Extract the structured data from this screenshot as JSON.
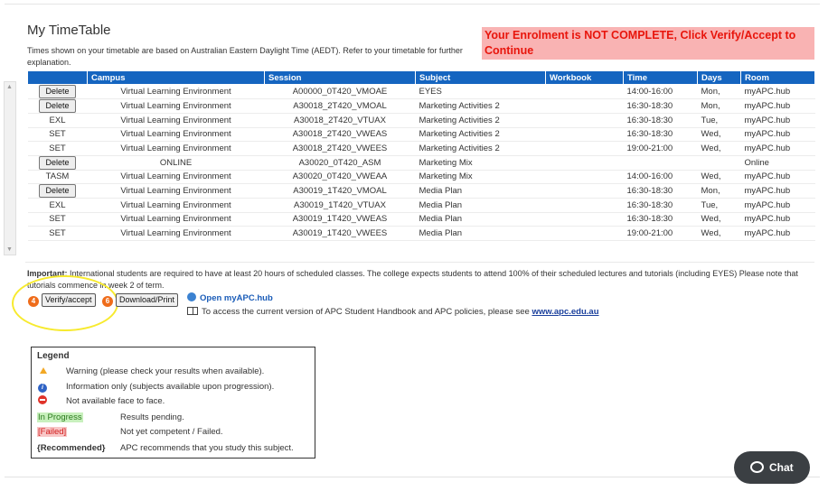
{
  "page_title": "My TimeTable",
  "timezone_notice": "Times shown on your timetable are based on Australian Eastern Daylight Time (AEDT). Refer to your timetable for further explanation.",
  "enrolment_warning": "Your Enrolment is NOT COMPLETE, Click Verify/Accept to Continue",
  "table": {
    "headers": [
      "",
      "Campus",
      "Session",
      "Subject",
      "Workbook",
      "Time",
      "Days",
      "Room"
    ],
    "rows": [
      {
        "action": "Delete",
        "action_is_button": true,
        "campus": "Virtual Learning Environment",
        "session": "A00000_0T420_VMOAE",
        "subject": "EYES",
        "workbook": "",
        "time": "14:00-16:00",
        "days": "Mon,",
        "room": "myAPC.hub"
      },
      {
        "action": "Delete",
        "action_is_button": true,
        "campus": "Virtual Learning Environment",
        "session": "A30018_2T420_VMOAL",
        "subject": "Marketing Activities 2",
        "workbook": "",
        "time": "16:30-18:30",
        "days": "Mon,",
        "room": "myAPC.hub"
      },
      {
        "action": "EXL",
        "action_is_button": false,
        "campus": "Virtual Learning Environment",
        "session": "A30018_2T420_VTUAX",
        "subject": "Marketing Activities 2",
        "workbook": "",
        "time": "16:30-18:30",
        "days": "Tue,",
        "room": "myAPC.hub"
      },
      {
        "action": "SET",
        "action_is_button": false,
        "campus": "Virtual Learning Environment",
        "session": "A30018_2T420_VWEAS",
        "subject": "Marketing Activities 2",
        "workbook": "",
        "time": "16:30-18:30",
        "days": "Wed,",
        "room": "myAPC.hub"
      },
      {
        "action": "SET",
        "action_is_button": false,
        "campus": "Virtual Learning Environment",
        "session": "A30018_2T420_VWEES",
        "subject": "Marketing Activities 2",
        "workbook": "",
        "time": "19:00-21:00",
        "days": "Wed,",
        "room": "myAPC.hub"
      },
      {
        "action": "Delete",
        "action_is_button": true,
        "campus": "ONLINE",
        "session": "A30020_0T420_ASM",
        "subject": "Marketing Mix",
        "workbook": "",
        "time": "",
        "days": "",
        "room": "Online"
      },
      {
        "action": "TASM",
        "action_is_button": false,
        "campus": "Virtual Learning Environment",
        "session": "A30020_0T420_VWEAA",
        "subject": "Marketing Mix",
        "workbook": "",
        "time": "14:00-16:00",
        "days": "Wed,",
        "room": "myAPC.hub"
      },
      {
        "action": "Delete",
        "action_is_button": true,
        "campus": "Virtual Learning Environment",
        "session": "A30019_1T420_VMOAL",
        "subject": "Media Plan",
        "workbook": "",
        "time": "16:30-18:30",
        "days": "Mon,",
        "room": "myAPC.hub"
      },
      {
        "action": "EXL",
        "action_is_button": false,
        "campus": "Virtual Learning Environment",
        "session": "A30019_1T420_VTUAX",
        "subject": "Media Plan",
        "workbook": "",
        "time": "16:30-18:30",
        "days": "Tue,",
        "room": "myAPC.hub"
      },
      {
        "action": "SET",
        "action_is_button": false,
        "campus": "Virtual Learning Environment",
        "session": "A30019_1T420_VWEAS",
        "subject": "Media Plan",
        "workbook": "",
        "time": "16:30-18:30",
        "days": "Wed,",
        "room": "myAPC.hub"
      },
      {
        "action": "SET",
        "action_is_button": false,
        "campus": "Virtual Learning Environment",
        "session": "A30019_1T420_VWEES",
        "subject": "Media Plan",
        "workbook": "",
        "time": "19:00-21:00",
        "days": "Wed,",
        "room": "myAPC.hub"
      }
    ]
  },
  "important_label": "Important:",
  "important_text": " International students are required to have at least 20 hours of scheduled classes. The college expects students to attend 100% of their scheduled lectures and tutorials (including EYES) Please note that tutorials commence in week 2 of term.",
  "actions": {
    "verify_step": "4",
    "verify_label": "Verify/accept",
    "download_step": "6",
    "download_label": "Download/Print"
  },
  "links": {
    "open_hub": "Open myAPC.hub",
    "policy_text": "To access the current version of APC Student Handbook and APC policies, please see ",
    "policy_link": "www.apc.edu.au"
  },
  "legend": {
    "title": "Legend",
    "items": [
      {
        "key_type": "warning-icon",
        "text": "Warning (please check your results when available)."
      },
      {
        "key_type": "info-icon",
        "text": "Information only (subjects available upon progression)."
      },
      {
        "key_type": "no-entry-icon",
        "text": "Not available face to face."
      },
      {
        "key_type": "label",
        "key": "In Progress",
        "text": "Results pending."
      },
      {
        "key_type": "label",
        "key": "[Failed]",
        "text": "Not yet competent / Failed."
      },
      {
        "key_type": "label",
        "key": "{Recommended}",
        "text": "APC recommends that you study this subject."
      }
    ]
  },
  "chat_label": "Chat",
  "colors": {
    "header_blue": "#1565c0",
    "warning_bg": "#f9b3b3",
    "warning_text": "#e8150c",
    "highlight": "#f7ea2e",
    "step_badge": "#ef6c1a"
  }
}
